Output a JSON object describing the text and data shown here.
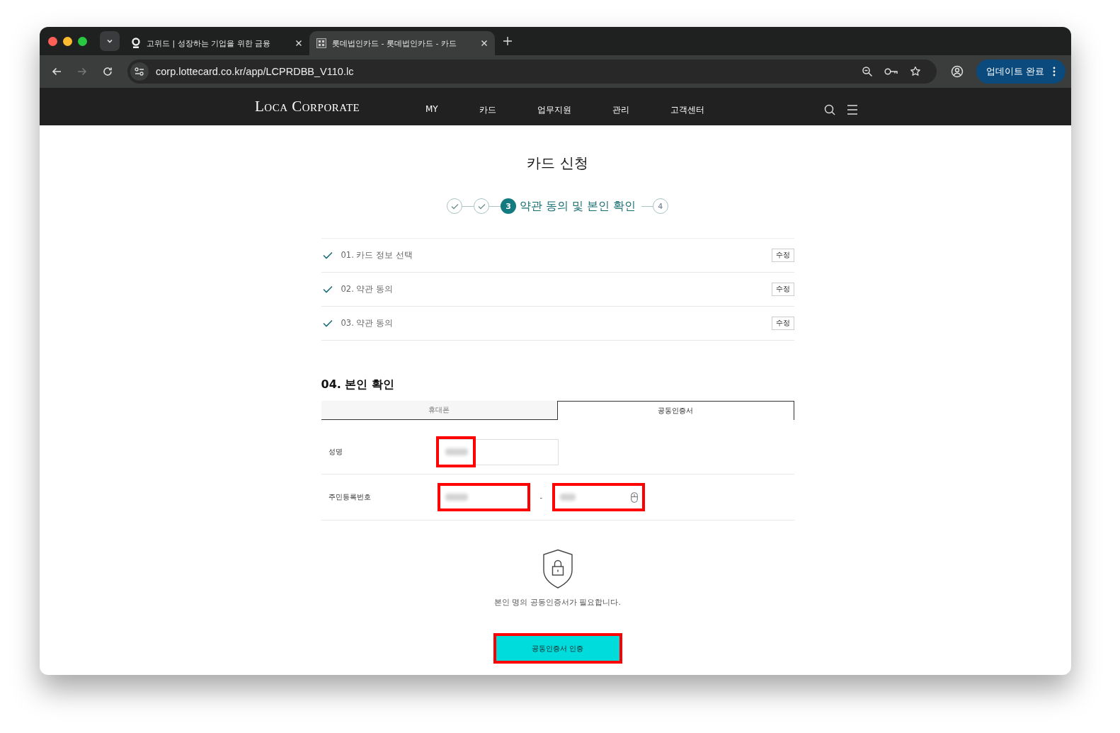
{
  "browser": {
    "tabs": [
      {
        "title": "고위드 | 성장하는 기업을 위한 금융",
        "selected": false
      },
      {
        "title": "롯데법인카드 - 롯데법인카드 - 카드",
        "selected": true
      }
    ],
    "url": "corp.lottecard.co.kr/app/LCPRDBB_V110.lc",
    "update_button": "업데이트 완료"
  },
  "site": {
    "logo": "Loca Corporate",
    "nav": [
      "MY",
      "카드",
      "업무지원",
      "관리",
      "고객센터"
    ]
  },
  "page": {
    "title": "카드 신청",
    "steps": [
      {
        "completed": true,
        "selected": false
      },
      {
        "completed": true,
        "selected": false
      },
      {
        "completed": false,
        "selected": true,
        "number": "3",
        "label": "약관 동의 및 본인 확인"
      },
      {
        "completed": false,
        "selected": false,
        "number": "4"
      }
    ],
    "completed_sections": [
      {
        "label": "01. 카드 정보 선택",
        "edit": "수정"
      },
      {
        "label": "02. 약관 동의",
        "edit": "수정"
      },
      {
        "label": "03. 약관 동의",
        "edit": "수정"
      }
    ],
    "identity": {
      "heading": "04. 본인 확인",
      "tabs": [
        {
          "label": "휴대폰",
          "selected": false
        },
        {
          "label": "공동인증서",
          "selected": true
        }
      ],
      "rows": [
        {
          "label": "성명",
          "fields": [
            {
              "kind": "name",
              "highlighted": true
            }
          ]
        },
        {
          "label": "주민등록번호",
          "separator": "-",
          "fields": [
            {
              "kind": "plain",
              "highlighted": true
            },
            {
              "kind": "secure",
              "highlighted": true
            }
          ]
        }
      ],
      "notice": "본인 명의 공동인증서가 필요합니다.",
      "button": {
        "label": "공동인증서 인증",
        "highlighted": true
      }
    }
  }
}
